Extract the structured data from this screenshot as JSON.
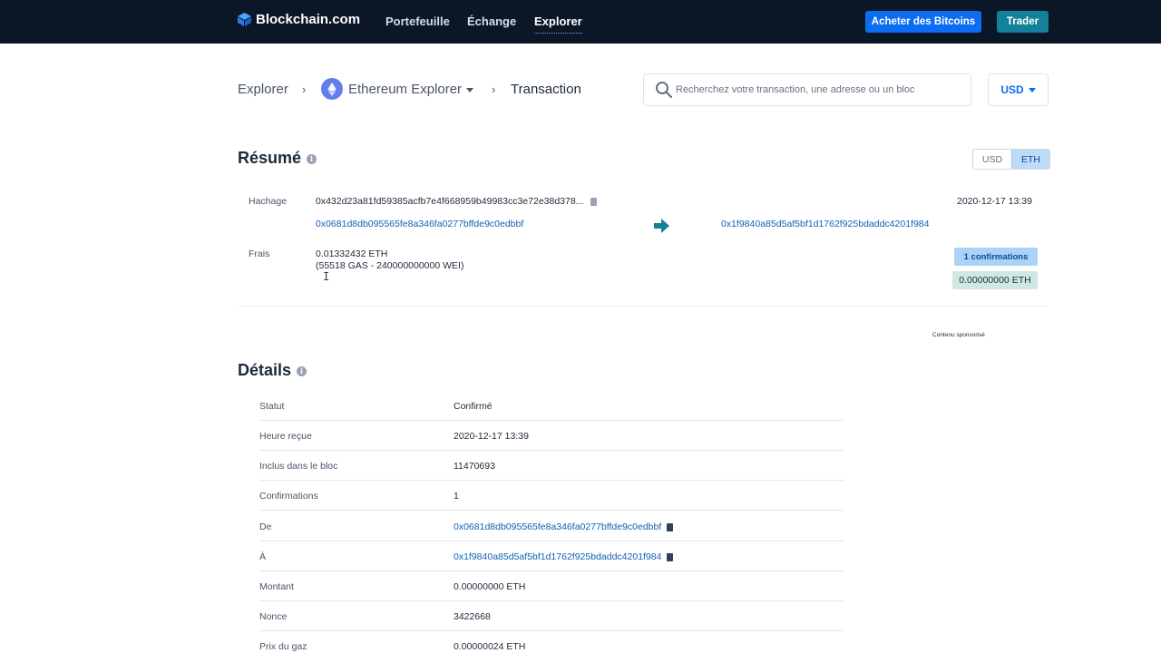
{
  "nav": {
    "brand": "Blockchain.com",
    "links": [
      "Portefeuille",
      "Échange",
      "Explorer"
    ],
    "active": "Explorer",
    "buy_label": "Acheter des Bitcoins",
    "trade_label": "Trader"
  },
  "breadcrumb": {
    "root": "Explorer",
    "explorer": "Ethereum Explorer",
    "current": "Transaction"
  },
  "search": {
    "placeholder": "Recherchez votre transaction, une adresse ou un bloc"
  },
  "currency_select": "USD",
  "summary": {
    "title": "Résumé",
    "toggle": [
      "USD",
      "ETH"
    ],
    "toggle_active": "ETH",
    "hash_label": "Hachage",
    "hash": "0x432d23a81fd59385acfb7e4f668959b49983cc3e72e38d378...",
    "timestamp": "2020-12-17 13:39",
    "from": "0x0681d8db095565fe8a346fa0277bffde9c0edbbf",
    "to": "0x1f9840a85d5af5bf1d1762f925bdaddc4201f984",
    "fee_label": "Frais",
    "fee": "0.01332432 ETH",
    "fee_detail": "(55518 GAS - 240000000000 WEI)",
    "confirmations_badge": "1 confirmations",
    "amount_badge": "0.00000000 ETH",
    "sponsored": "Contenu sponsorisé"
  },
  "details": {
    "title": "Détails",
    "rows": [
      {
        "k": "Statut",
        "v": "Confirmé"
      },
      {
        "k": "Heure reçue",
        "v": "2020-12-17 13:39"
      },
      {
        "k": "Inclus dans le bloc",
        "v": "11470693"
      },
      {
        "k": "Confirmations",
        "v": "1"
      },
      {
        "k": "De",
        "v": "0x0681d8db095565fe8a346fa0277bffde9c0edbbf"
      },
      {
        "k": "À",
        "v": "0x1f9840a85d5af5bf1d1762f925bdaddc4201f984"
      },
      {
        "k": "Montant",
        "v": "0.00000000 ETH"
      },
      {
        "k": "Nonce",
        "v": "3422668"
      },
      {
        "k": "Prix du gaz",
        "v": "0.00000024 ETH"
      }
    ]
  },
  "colors": {
    "nav_bg": "#0b1726",
    "primary": "#0c6cf2",
    "trade": "#13819a",
    "link": "#1060b8"
  }
}
